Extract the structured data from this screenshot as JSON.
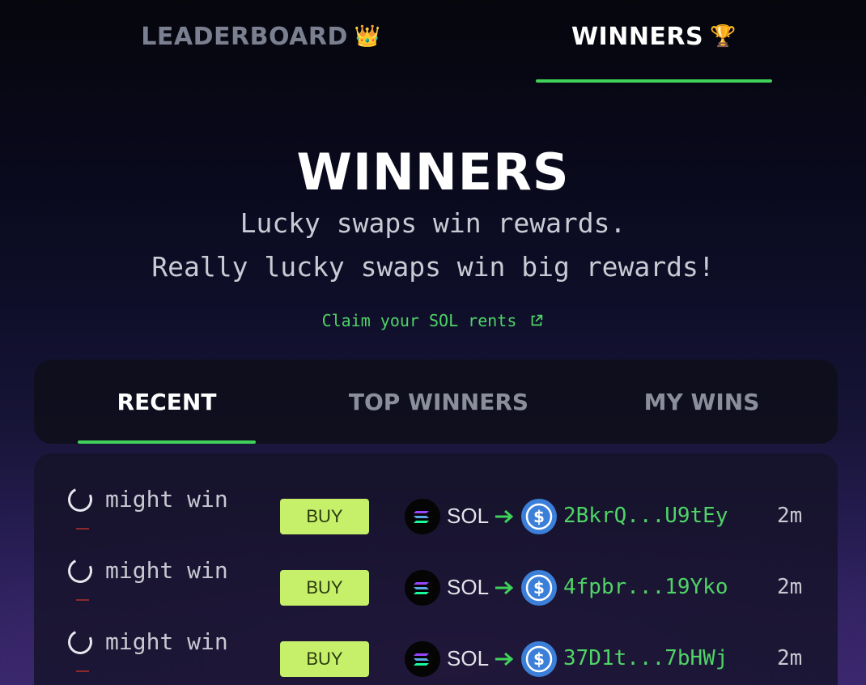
{
  "top_tabs": {
    "leaderboard": {
      "label": "LEADERBOARD",
      "emoji": "👑"
    },
    "winners": {
      "label": "WINNERS",
      "emoji": "🏆"
    }
  },
  "hero": {
    "title": "WINNERS",
    "subtitle_line1": "Lucky swaps win rewards.",
    "subtitle_line2": "Really lucky swaps win big rewards!",
    "claim_link": "Claim your SOL rents",
    "claim_icon": "external-link-icon"
  },
  "sub_tabs": {
    "recent": "RECENT",
    "top_winners": "TOP WINNERS",
    "my_wins": "MY WINS",
    "active": "RECENT"
  },
  "rows": [
    {
      "status": "might win",
      "action": "BUY",
      "from_token": "SOL",
      "to_token_icon": "usdc-icon",
      "address": "2BkrQ...U9tEy",
      "time": "2m"
    },
    {
      "status": "might win",
      "action": "BUY",
      "from_token": "SOL",
      "to_token_icon": "usdc-icon",
      "address": "4fpbr...19Yko",
      "time": "2m"
    },
    {
      "status": "might win",
      "action": "BUY",
      "from_token": "SOL",
      "to_token_icon": "usdc-icon",
      "address": "37D1t...7bHWj",
      "time": "2m"
    }
  ],
  "colors": {
    "accent_green": "#3fd15a",
    "buy_button": "#c7f06a",
    "usdc_blue": "#3b7fd9"
  }
}
